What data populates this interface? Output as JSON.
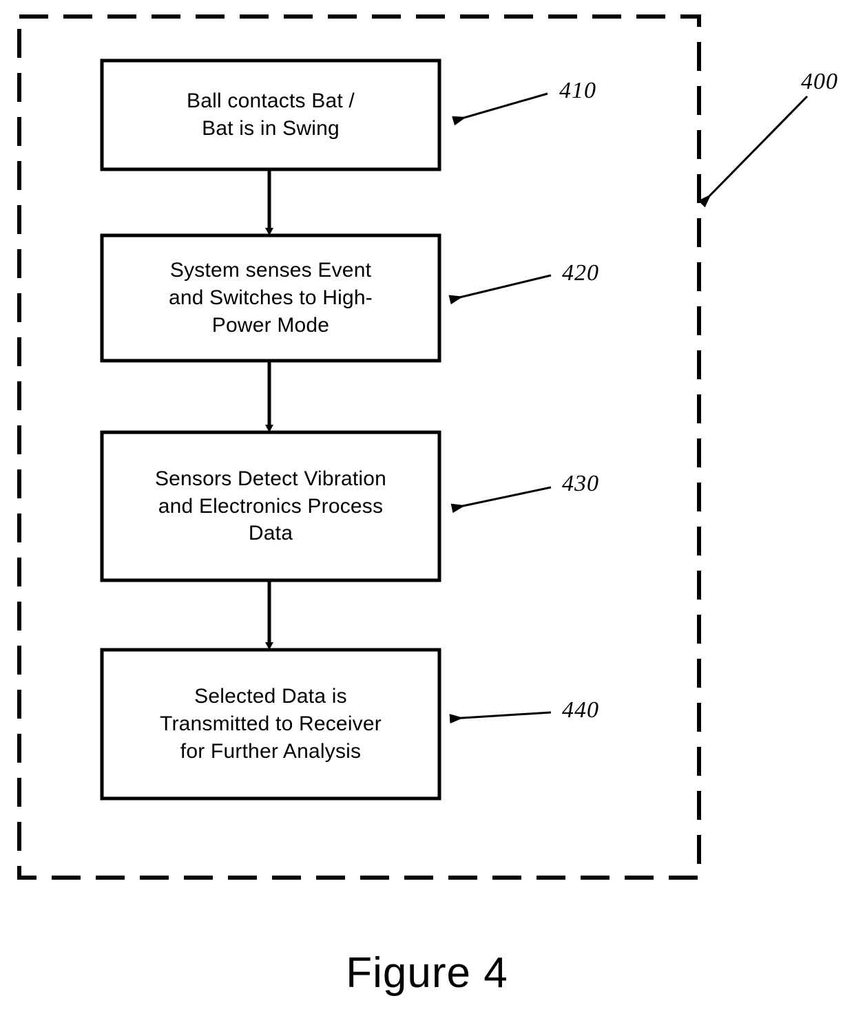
{
  "figure": {
    "caption": "Figure 4",
    "system_ref": "400"
  },
  "container": {
    "name": "system-boundary",
    "style": "dashed",
    "ref": "400"
  },
  "flow": {
    "steps": [
      {
        "id": "step-410",
        "ref": "410",
        "text": "Ball contacts Bat /\nBat is in Swing"
      },
      {
        "id": "step-420",
        "ref": "420",
        "text": "System senses Event\nand Switches to High-\nPower Mode"
      },
      {
        "id": "step-430",
        "ref": "430",
        "text": "Sensors Detect Vibration\nand Electronics Process\nData"
      },
      {
        "id": "step-440",
        "ref": "440",
        "text": "Selected Data is\nTransmitted to Receiver\nfor Further Analysis"
      }
    ],
    "connectors": [
      {
        "name": "connector-410-to-420",
        "from": "step-410",
        "to": "step-420"
      },
      {
        "name": "connector-420-to-430",
        "from": "step-420",
        "to": "step-430"
      },
      {
        "name": "connector-430-to-440",
        "from": "step-430",
        "to": "step-440"
      }
    ]
  },
  "colors": {
    "ink": "#000000",
    "paper": "#ffffff"
  }
}
